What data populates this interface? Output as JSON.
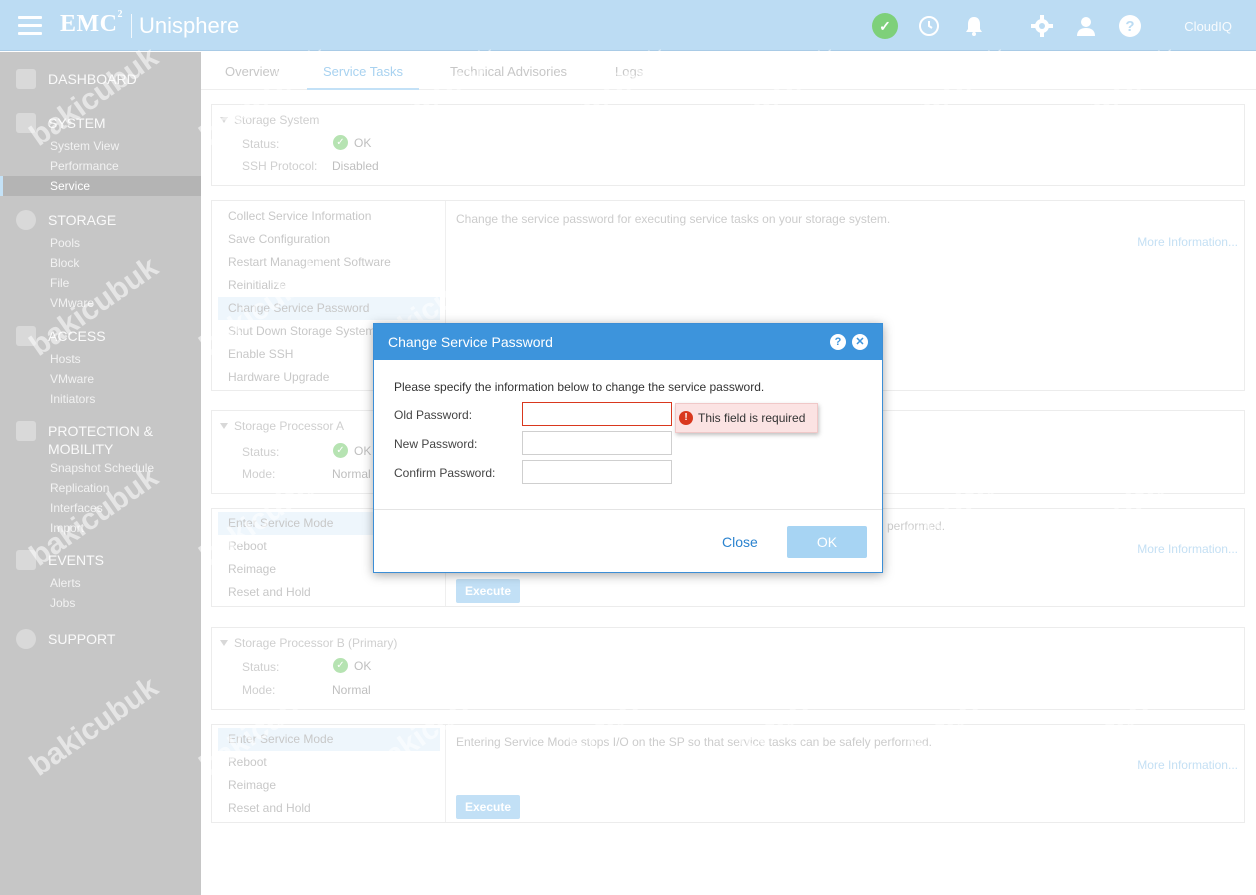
{
  "header": {
    "brand": "EMC",
    "brand_sup": "2",
    "app_name": "Unisphere",
    "cloudiq": "CloudIQ",
    "icons": [
      "check-circle-icon",
      "clock-icon",
      "bell-icon",
      "gear-icon",
      "user-icon",
      "help-icon"
    ]
  },
  "sidebar": {
    "sections": [
      {
        "label": "DASHBOARD",
        "icon": "dashboard-icon",
        "items": []
      },
      {
        "label": "SYSTEM",
        "icon": "system-icon",
        "items": [
          "System View",
          "Performance",
          "Service"
        ]
      },
      {
        "label": "STORAGE",
        "icon": "storage-icon",
        "items": [
          "Pools",
          "Block",
          "File",
          "VMware"
        ]
      },
      {
        "label": "ACCESS",
        "icon": "access-icon",
        "items": [
          "Hosts",
          "VMware",
          "Initiators"
        ]
      },
      {
        "label": "PROTECTION &",
        "label2": "MOBILITY",
        "icon": "shield-icon",
        "items": [
          "Snapshot Schedule",
          "Replication",
          "Interfaces",
          "Import"
        ]
      },
      {
        "label": "EVENTS",
        "icon": "events-icon",
        "items": [
          "Alerts",
          "Jobs"
        ]
      },
      {
        "label": "SUPPORT",
        "icon": "support-icon",
        "items": []
      }
    ],
    "active_item": "Service"
  },
  "tabs": [
    "Overview",
    "Service Tasks",
    "Technical Advisories",
    "Logs"
  ],
  "active_tab": "Service Tasks",
  "storage_system": {
    "title": "Storage System",
    "status_label": "Status:",
    "status_value": "OK",
    "ssh_label": "SSH Protocol:",
    "ssh_value": "Disabled"
  },
  "system_tasks": {
    "items": [
      "Collect Service Information",
      "Save Configuration",
      "Restart Management Software",
      "Reinitialize",
      "Change Service Password",
      "Shut Down Storage System",
      "Enable SSH",
      "Hardware Upgrade"
    ],
    "selected": "Change Service Password",
    "description": "Change the service password for executing service tasks on your storage system.",
    "more": "More Information..."
  },
  "spa": {
    "title": "Storage Processor A",
    "status_label": "Status:",
    "status_value": "OK",
    "mode_label": "Mode:",
    "mode_value": "Normal",
    "tasks": [
      "Enter Service Mode",
      "Reboot",
      "Reimage",
      "Reset and Hold"
    ],
    "description_tail": "performed.",
    "more": "More Information...",
    "execute": "Execute"
  },
  "spb": {
    "title": "Storage Processor B (Primary)",
    "status_label": "Status:",
    "status_value": "OK",
    "mode_label": "Mode:",
    "mode_value": "Normal",
    "tasks": [
      "Enter Service Mode",
      "Reboot",
      "Reimage",
      "Reset and Hold"
    ],
    "description": "Entering Service Mode stops I/O on the SP so that service tasks can be safely performed.",
    "more": "More Information...",
    "execute": "Execute"
  },
  "modal": {
    "title": "Change Service Password",
    "intro": "Please specify the information below to change the service password.",
    "old_label": "Old Password:",
    "new_label": "New Password:",
    "confirm_label": "Confirm Password:",
    "old_value": "",
    "new_value": "",
    "confirm_value": "",
    "error": "This field is required",
    "close": "Close",
    "ok": "OK"
  },
  "watermark": "bakicubuk",
  "colors": {
    "topbar": "#bcdcf3",
    "modal_header": "#3d94dc",
    "error": "#d9381e",
    "link": "#2b83cf"
  }
}
